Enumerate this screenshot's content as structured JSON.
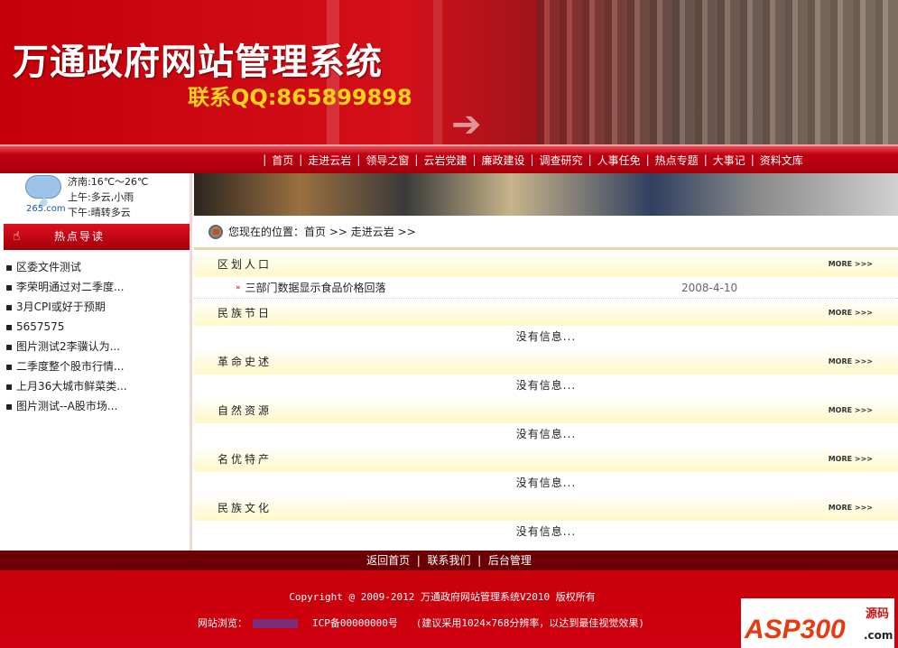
{
  "header": {
    "title": "万通政府网站管理系统",
    "contact": "联系QQ:865899898"
  },
  "nav": [
    "首页",
    "走进云岩",
    "领导之窗",
    "云岩党建",
    "廉政建设",
    "调查研究",
    "人事任免",
    "热点专题",
    "大事记",
    "资料文库"
  ],
  "weather": {
    "provider": "265.com",
    "city": "济南:16℃～26℃",
    "morning": "上午:多云,小雨",
    "afternoon": "下午:晴转多云"
  },
  "hot": {
    "title": "热点导读",
    "items": [
      "区委文件测试",
      "李荣明通过对二季度...",
      "3月CPI或好于预期",
      "5657575",
      "图片测试2李骥认为...",
      "二季度整个股市行情...",
      "上月36大城市鲜菜类...",
      "图片测试--A股市场..."
    ]
  },
  "breadcrumb": {
    "label": "您现在的位置：",
    "home": "首页",
    "sep": ">>",
    "current": "走进云岩",
    "sep2": ">>"
  },
  "more_label": "MORE >>>",
  "sections": [
    {
      "title": "区划人口",
      "items": [
        {
          "title": "三部门数据显示食品价格回落",
          "date": "2008-4-10"
        }
      ]
    },
    {
      "title": "民族节日",
      "empty": "没有信息..."
    },
    {
      "title": "革命史述",
      "empty": "没有信息..."
    },
    {
      "title": "自然资源",
      "empty": "没有信息..."
    },
    {
      "title": "名优特产",
      "empty": "没有信息..."
    },
    {
      "title": "民族文化",
      "empty": "没有信息..."
    }
  ],
  "footer": {
    "links": [
      "返回首页",
      "联系我们",
      "后台管理"
    ],
    "copyright": "Copyright @ 2009-2012 万通政府网站管理系统V2010 版权所有",
    "visits_label": "网站浏览：",
    "icp": "ICP备00000000号",
    "tip": "(建议采用1024×768分辨率，以达到最佳视觉效果)"
  },
  "logo": {
    "text": "ASP300",
    "sub": "源码",
    "domain": ".com"
  }
}
